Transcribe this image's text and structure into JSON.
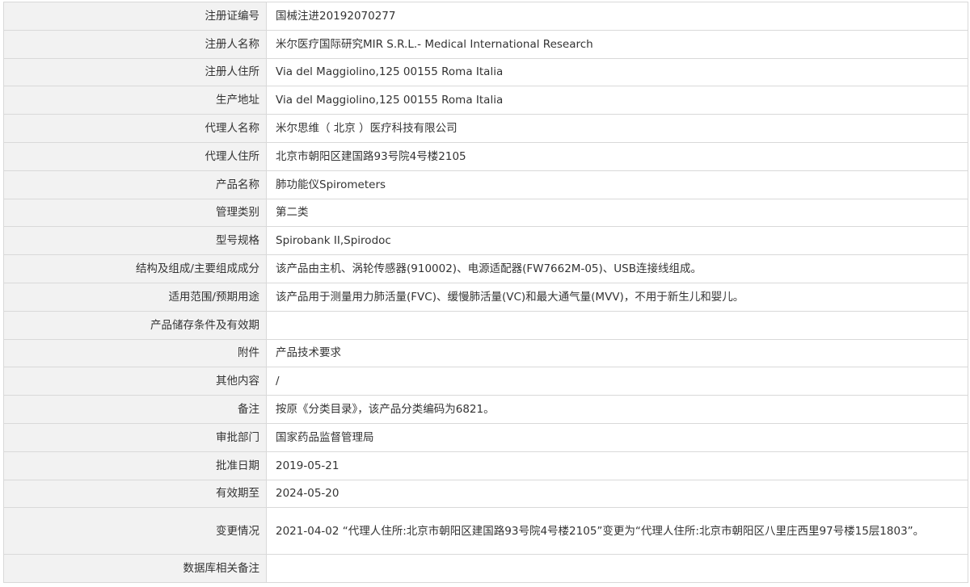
{
  "rows": [
    {
      "label": "注册证编号",
      "value": "国械注进20192070277"
    },
    {
      "label": "注册人名称",
      "value": "米尔医疗国际研究MIR S.R.L.- Medical International Research"
    },
    {
      "label": "注册人住所",
      "value": "Via del Maggiolino,125 00155 Roma Italia"
    },
    {
      "label": "生产地址",
      "value": "Via del Maggiolino,125 00155 Roma Italia"
    },
    {
      "label": "代理人名称",
      "value": "米尔思维（ 北京 ）医疗科技有限公司"
    },
    {
      "label": "代理人住所",
      "value": "北京市朝阳区建国路93号院4号楼2105"
    },
    {
      "label": "产品名称",
      "value": "肺功能仪Spirometers"
    },
    {
      "label": "管理类别",
      "value": "第二类"
    },
    {
      "label": "型号规格",
      "value": "Spirobank II,Spirodoc"
    },
    {
      "label": "结构及组成/主要组成成分",
      "value": "该产品由主机、涡轮传感器(910002)、电源适配器(FW7662M-05)、USB连接线组成。"
    },
    {
      "label": "适用范围/预期用途",
      "value": "该产品用于测量用力肺活量(FVC)、缓慢肺活量(VC)和最大通气量(MVV)，不用于新生儿和婴儿。"
    },
    {
      "label": "产品储存条件及有效期",
      "value": ""
    },
    {
      "label": "附件",
      "value": "产品技术要求"
    },
    {
      "label": "其他内容",
      "value": "/"
    },
    {
      "label": "备注",
      "value": "按原《分类目录》，该产品分类编码为6821。"
    },
    {
      "label": "审批部门",
      "value": "国家药品监督管理局"
    },
    {
      "label": "批准日期",
      "value": "2019-05-21"
    },
    {
      "label": "有效期至",
      "value": "2024-05-20"
    },
    {
      "label": "变更情况",
      "value": "2021-04-02 “代理人住所:北京市朝阳区建国路93号院4号楼2105”变更为“代理人住所:北京市朝阳区八里庄西里97号楼15层1803”。"
    },
    {
      "label": "数据库相关备注",
      "value": ""
    }
  ]
}
